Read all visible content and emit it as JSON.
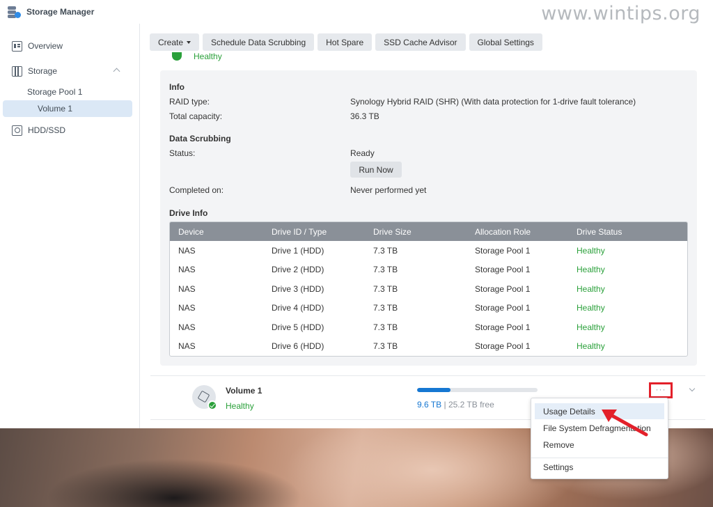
{
  "app": {
    "title": "Storage Manager"
  },
  "watermark": "www.wintips.org",
  "sidebar": {
    "items": [
      {
        "label": "Overview"
      },
      {
        "label": "Storage"
      },
      {
        "label": "Storage Pool 1"
      },
      {
        "label": "Volume 1"
      },
      {
        "label": "HDD/SSD"
      }
    ]
  },
  "toolbar": {
    "buttons": [
      {
        "label": "Create"
      },
      {
        "label": "Schedule Data Scrubbing"
      },
      {
        "label": "Hot Spare"
      },
      {
        "label": "SSD Cache Advisor"
      },
      {
        "label": "Global Settings"
      }
    ]
  },
  "pool": {
    "status": "Healthy"
  },
  "info": {
    "title": "Info",
    "raid_label": "RAID type:",
    "raid_value": "Synology Hybrid RAID (SHR) (With data protection for 1-drive fault tolerance)",
    "capacity_label": "Total capacity:",
    "capacity_value": "36.3 TB"
  },
  "scrubbing": {
    "title": "Data Scrubbing",
    "status_label": "Status:",
    "status_value": "Ready",
    "run_button": "Run Now",
    "completed_label": "Completed on:",
    "completed_value": "Never performed yet"
  },
  "drive_info": {
    "title": "Drive Info",
    "headers": [
      "Device",
      "Drive ID / Type",
      "Drive Size",
      "Allocation Role",
      "Drive Status"
    ],
    "rows": [
      [
        "NAS",
        "Drive 1 (HDD)",
        "7.3 TB",
        "Storage Pool 1",
        "Healthy"
      ],
      [
        "NAS",
        "Drive 2 (HDD)",
        "7.3 TB",
        "Storage Pool 1",
        "Healthy"
      ],
      [
        "NAS",
        "Drive 3 (HDD)",
        "7.3 TB",
        "Storage Pool 1",
        "Healthy"
      ],
      [
        "NAS",
        "Drive 4 (HDD)",
        "7.3 TB",
        "Storage Pool 1",
        "Healthy"
      ],
      [
        "NAS",
        "Drive 5 (HDD)",
        "7.3 TB",
        "Storage Pool 1",
        "Healthy"
      ],
      [
        "NAS",
        "Drive 6 (HDD)",
        "7.3 TB",
        "Storage Pool 1",
        "Healthy"
      ]
    ]
  },
  "volume": {
    "name": "Volume 1",
    "status": "Healthy",
    "used": "9.6 TB",
    "separator": " | ",
    "free": "25.2 TB free",
    "usage_fraction": 0.28,
    "more_label": "···"
  },
  "context_menu": {
    "items": [
      {
        "label": "Usage Details"
      },
      {
        "label": "File System Defragmentation"
      },
      {
        "label": "Remove"
      },
      {
        "label": "Settings"
      }
    ]
  },
  "colors": {
    "healthy": "#2aa03a",
    "accent": "#1677d2",
    "highlight_box": "#e3202a"
  }
}
